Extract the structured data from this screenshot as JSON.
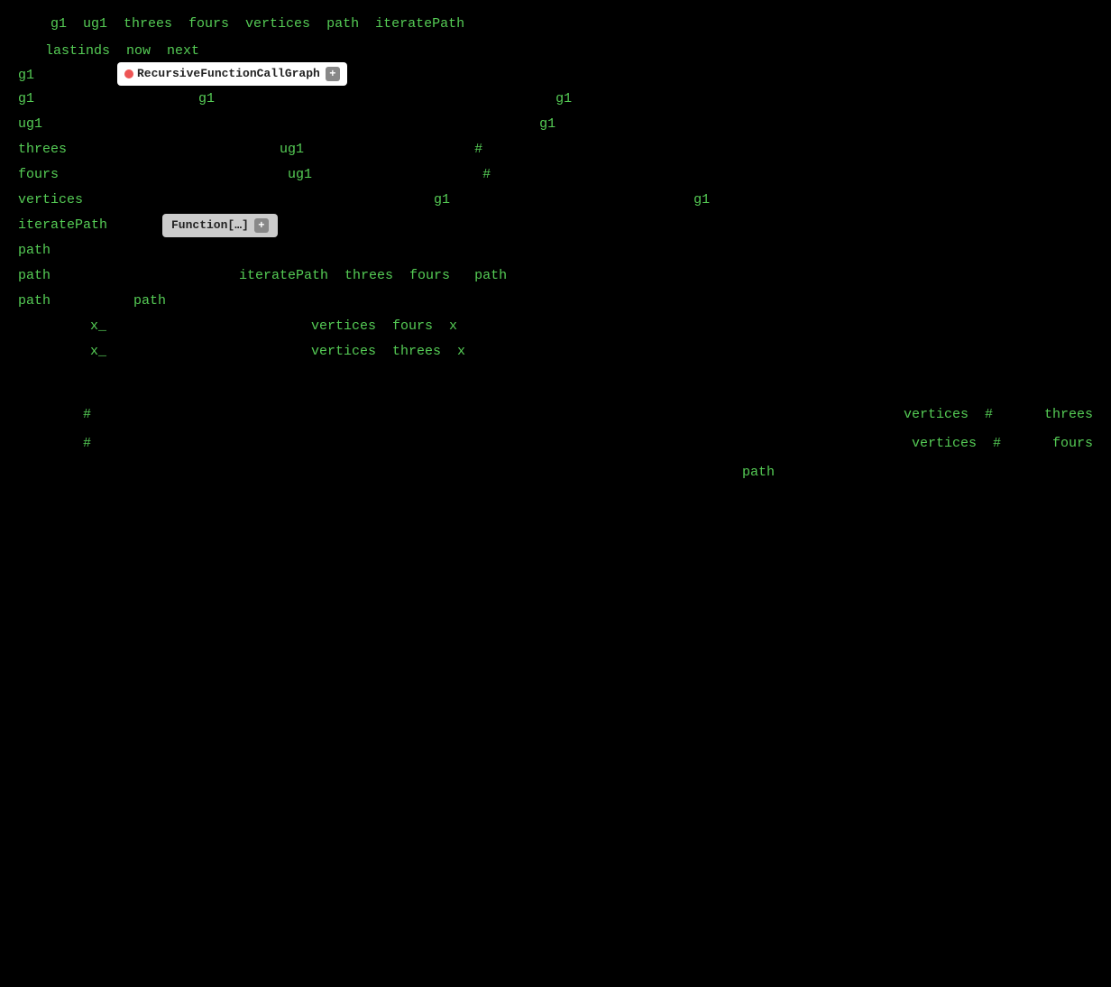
{
  "header": {
    "vars": "g1  ug1  threes  fours  vertices  path  iteratePath",
    "row2": "lastinds  now  next"
  },
  "rows": [
    {
      "label": "g1",
      "badge_type": "rfcg",
      "badge_text": "RecursiveFunctionCallGraph",
      "content": ""
    },
    {
      "label": "g1",
      "content_parts": [
        "g1",
        "                                    g1"
      ]
    },
    {
      "label": "ug1",
      "content_parts": [
        "                                          g1"
      ]
    },
    {
      "label": "threes",
      "content_parts": [
        "               ug1                    #"
      ]
    },
    {
      "label": "fours",
      "content_parts": [
        "               ug1                    #"
      ]
    },
    {
      "label": "vertices",
      "content_parts": [
        "                                    g1                              g1"
      ]
    },
    {
      "label": "iteratePath",
      "badge_type": "function",
      "badge_text": "Function[…]",
      "content": ""
    },
    {
      "label": "path",
      "content": ""
    },
    {
      "label": "path",
      "content_parts": [
        "           iteratePath  threes  fours   path"
      ]
    },
    {
      "label": "path",
      "sub": "path",
      "content": ""
    }
  ],
  "indent_rows": [
    {
      "label": "x_",
      "content": "               vertices  fours  x"
    },
    {
      "label": "x_",
      "content": "               vertices  threes  x"
    }
  ],
  "bottom_rows": [
    {
      "hash": "#",
      "middle": "                                                    ",
      "right_label": "vertices  #",
      "right_word": "threes"
    },
    {
      "hash": "#",
      "middle": "                                                    ",
      "right_label": " vertices  #",
      "right_word": "fours"
    }
  ],
  "bottom_path": "path",
  "icons": {
    "red_dot": "●",
    "plus": "+",
    "ellipsis": "…"
  }
}
